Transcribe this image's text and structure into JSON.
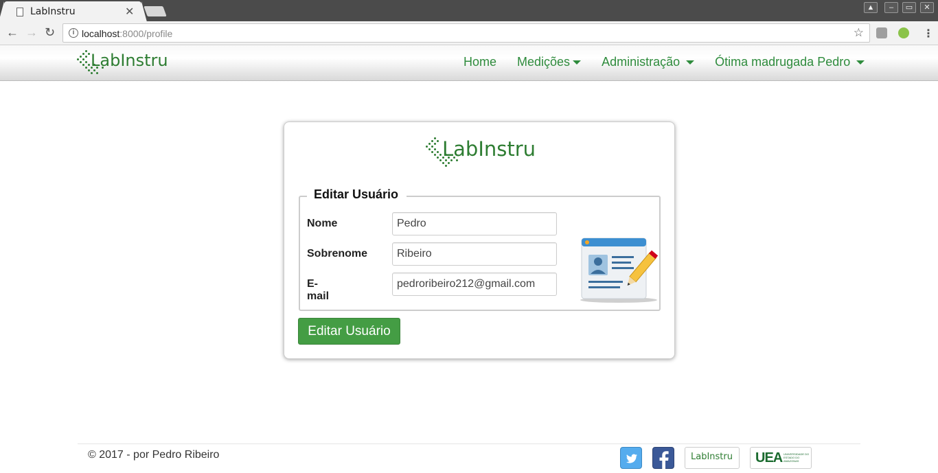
{
  "browser": {
    "tab_title": "LabInstru",
    "tab_close": "✕",
    "url_host": "localhost",
    "url_rest": ":8000/profile",
    "back": "←",
    "forward": "→",
    "reload": "↻",
    "star": "☆",
    "info": "i",
    "window_buttons": [
      "▲",
      "–",
      "▭",
      "✕"
    ]
  },
  "brand": {
    "name": "LabInstru",
    "color": "#2e7d32"
  },
  "nav": {
    "home": "Home",
    "measurements": "Medições",
    "administration": "Administração",
    "user_menu": "Ótima madrugada Pedro"
  },
  "form": {
    "legend": "Editar Usuário",
    "fields": [
      {
        "label": "Nome",
        "value": "Pedro"
      },
      {
        "label": "Sobrenome",
        "value": "Ribeiro"
      },
      {
        "label": "E-mail",
        "value": "pedroribeiro212@gmail.com"
      }
    ],
    "submit_label": "Editar Usuário"
  },
  "footer": {
    "copyright": "© 2017 - por Pedro Ribeiro",
    "badge_labinstru": "LabInstru",
    "badge_uea": "UEA",
    "badge_uea_sub": "UNIVERSIDADE DO ESTADO DO AMAZONAS"
  },
  "icons": {
    "tab_favicon": "page-icon",
    "info": "info-icon",
    "star": "star-icon",
    "twitter": "twitter-icon",
    "facebook": "facebook-icon",
    "profile_card": "profile-edit-icon"
  },
  "colors": {
    "accent_green": "#2e8b3c",
    "button_green": "#449d44"
  }
}
